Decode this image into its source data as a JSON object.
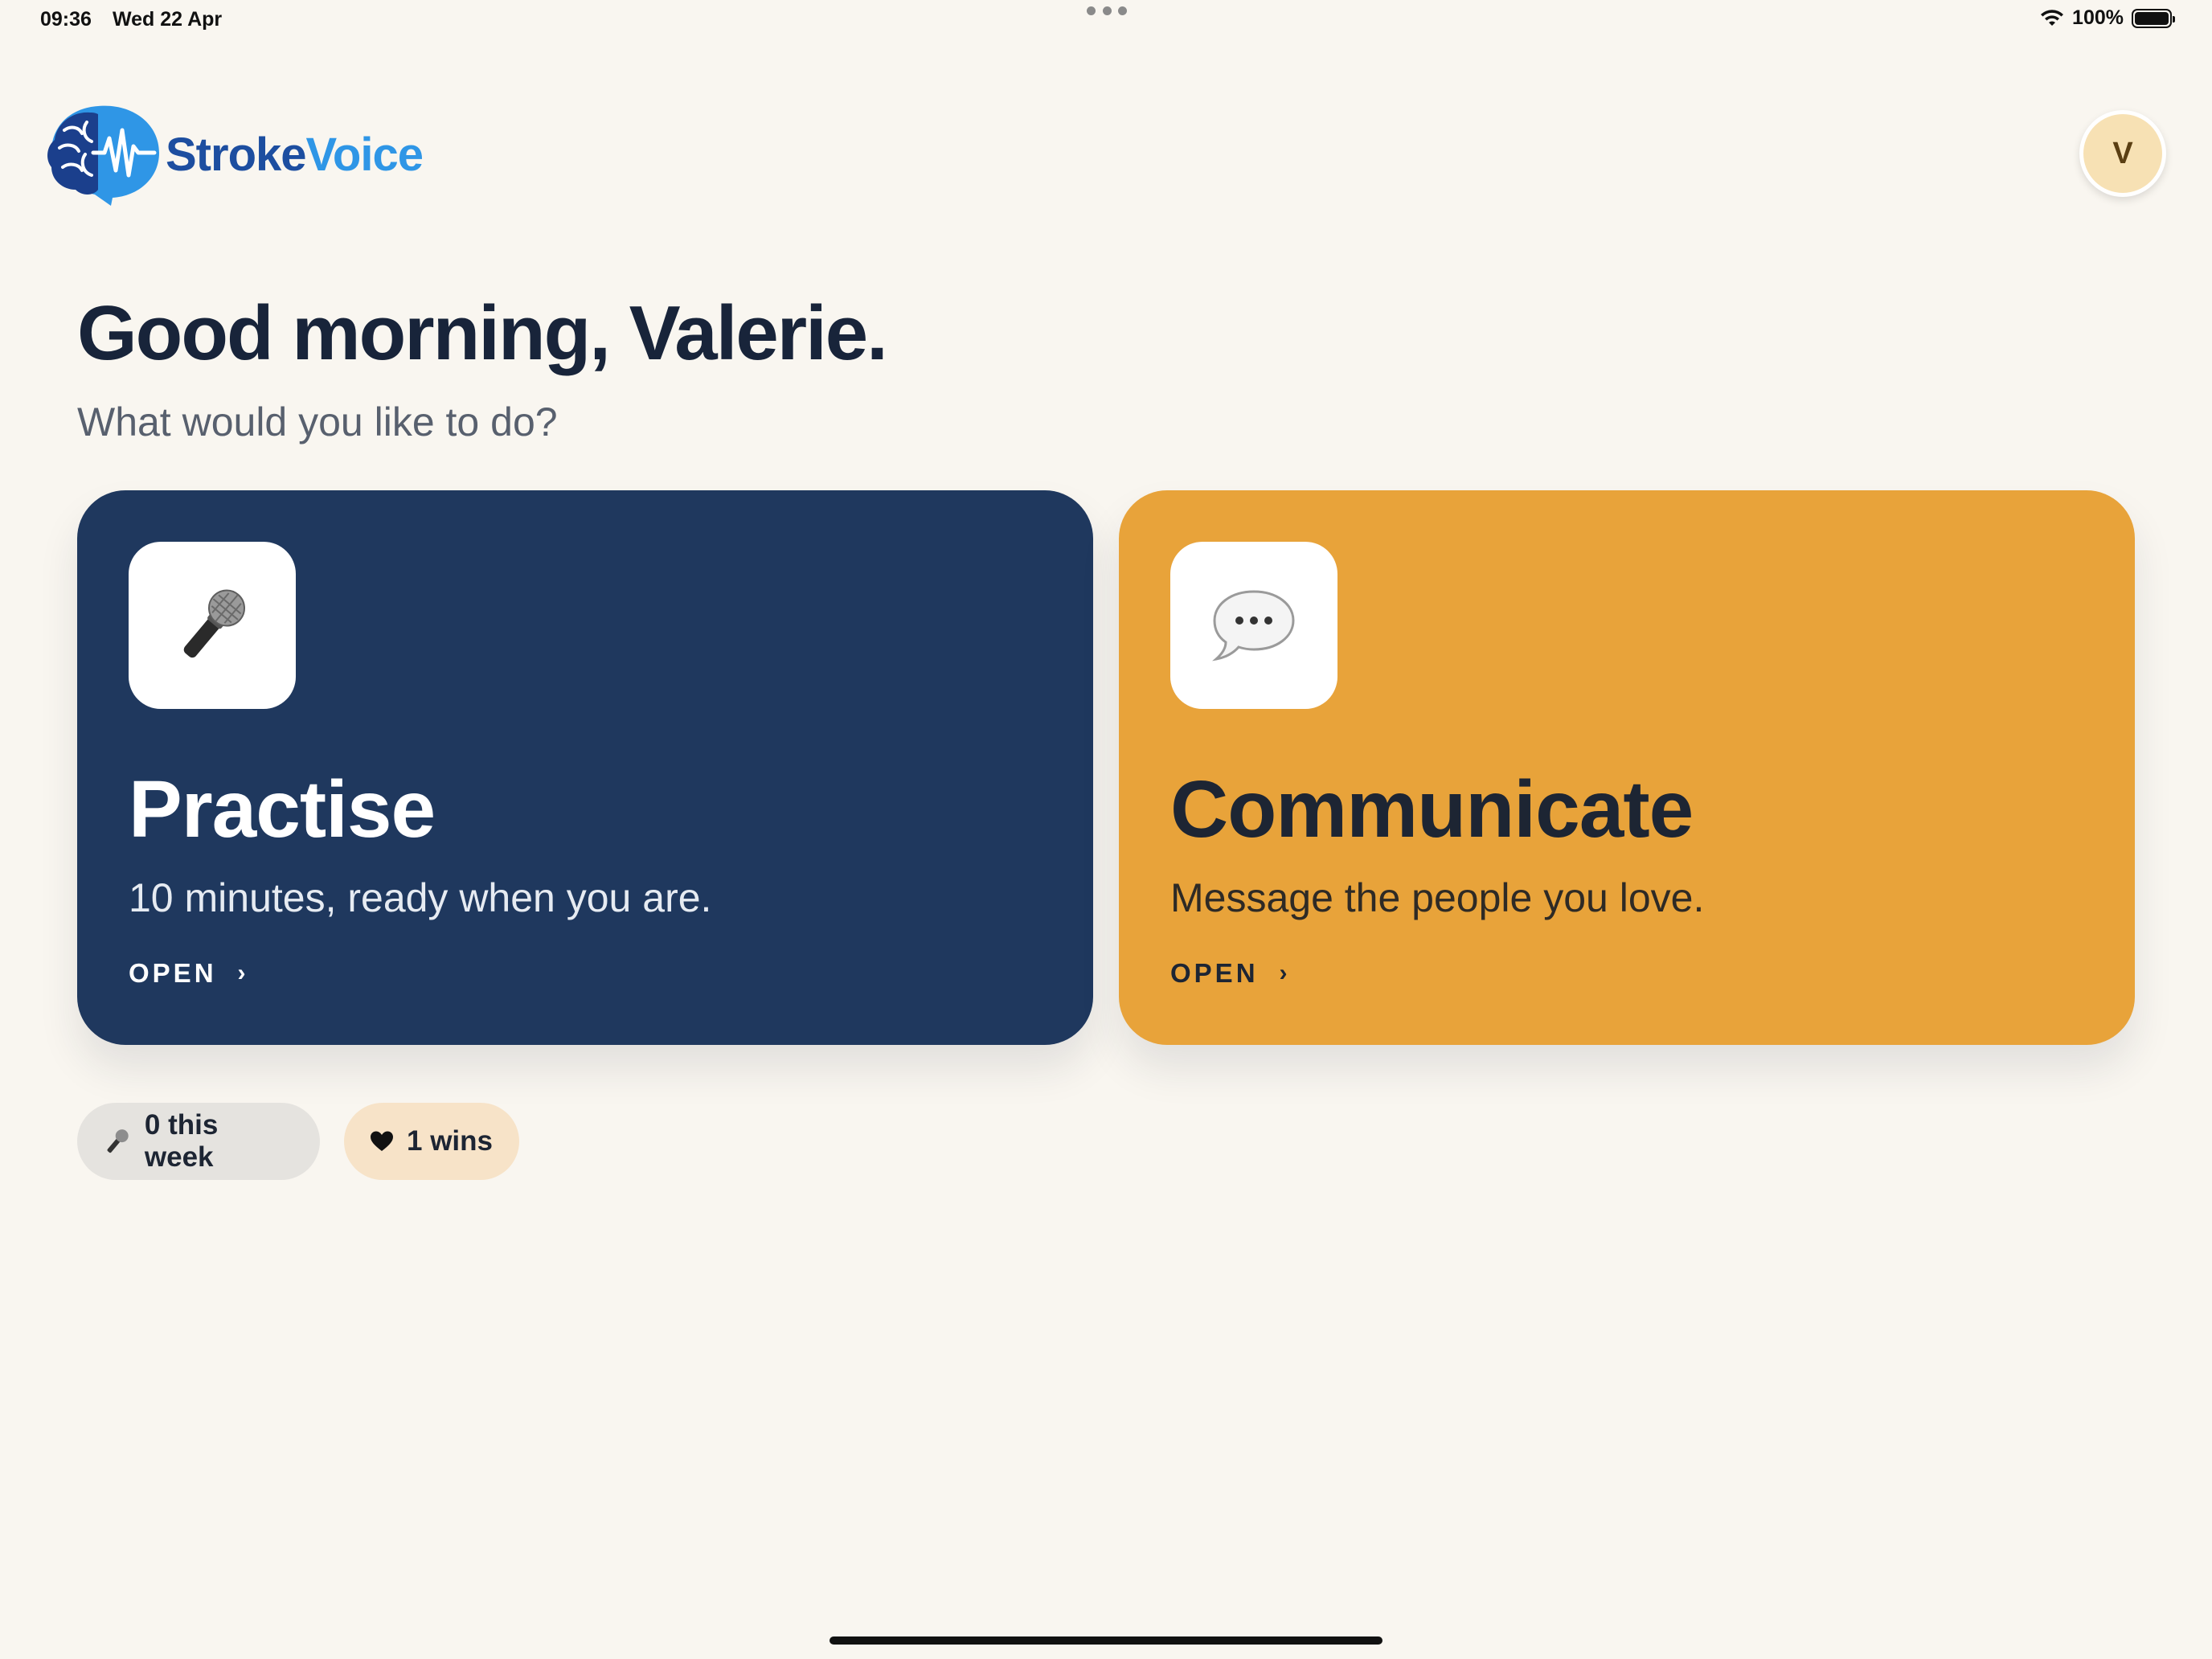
{
  "status_bar": {
    "time": "09:36",
    "date": "Wed 22 Apr",
    "battery": "100%"
  },
  "header": {
    "brand_part1": "Stroke",
    "brand_part2": "Voice",
    "avatar_initial": "V"
  },
  "main": {
    "greeting": "Good morning, Valerie.",
    "subtitle": "What would you like to do?",
    "cards": [
      {
        "title": "Practise",
        "description": "10 minutes, ready when you are.",
        "action": "OPEN",
        "icon": "microphone-icon",
        "color": "#1f385e"
      },
      {
        "title": "Communicate",
        "description": "Message the people you love.",
        "action": "OPEN",
        "icon": "speech-bubble-icon",
        "color": "#e8a33a"
      }
    ],
    "stats": [
      {
        "label": "0 this week",
        "icon": "microphone-icon"
      },
      {
        "label": "1 wins",
        "icon": "heart-icon"
      }
    ]
  },
  "colors": {
    "background": "#f9f6f0",
    "brand_dark_blue": "#1d4ea0",
    "brand_light_blue": "#2f96e6",
    "heading": "#18243a"
  }
}
